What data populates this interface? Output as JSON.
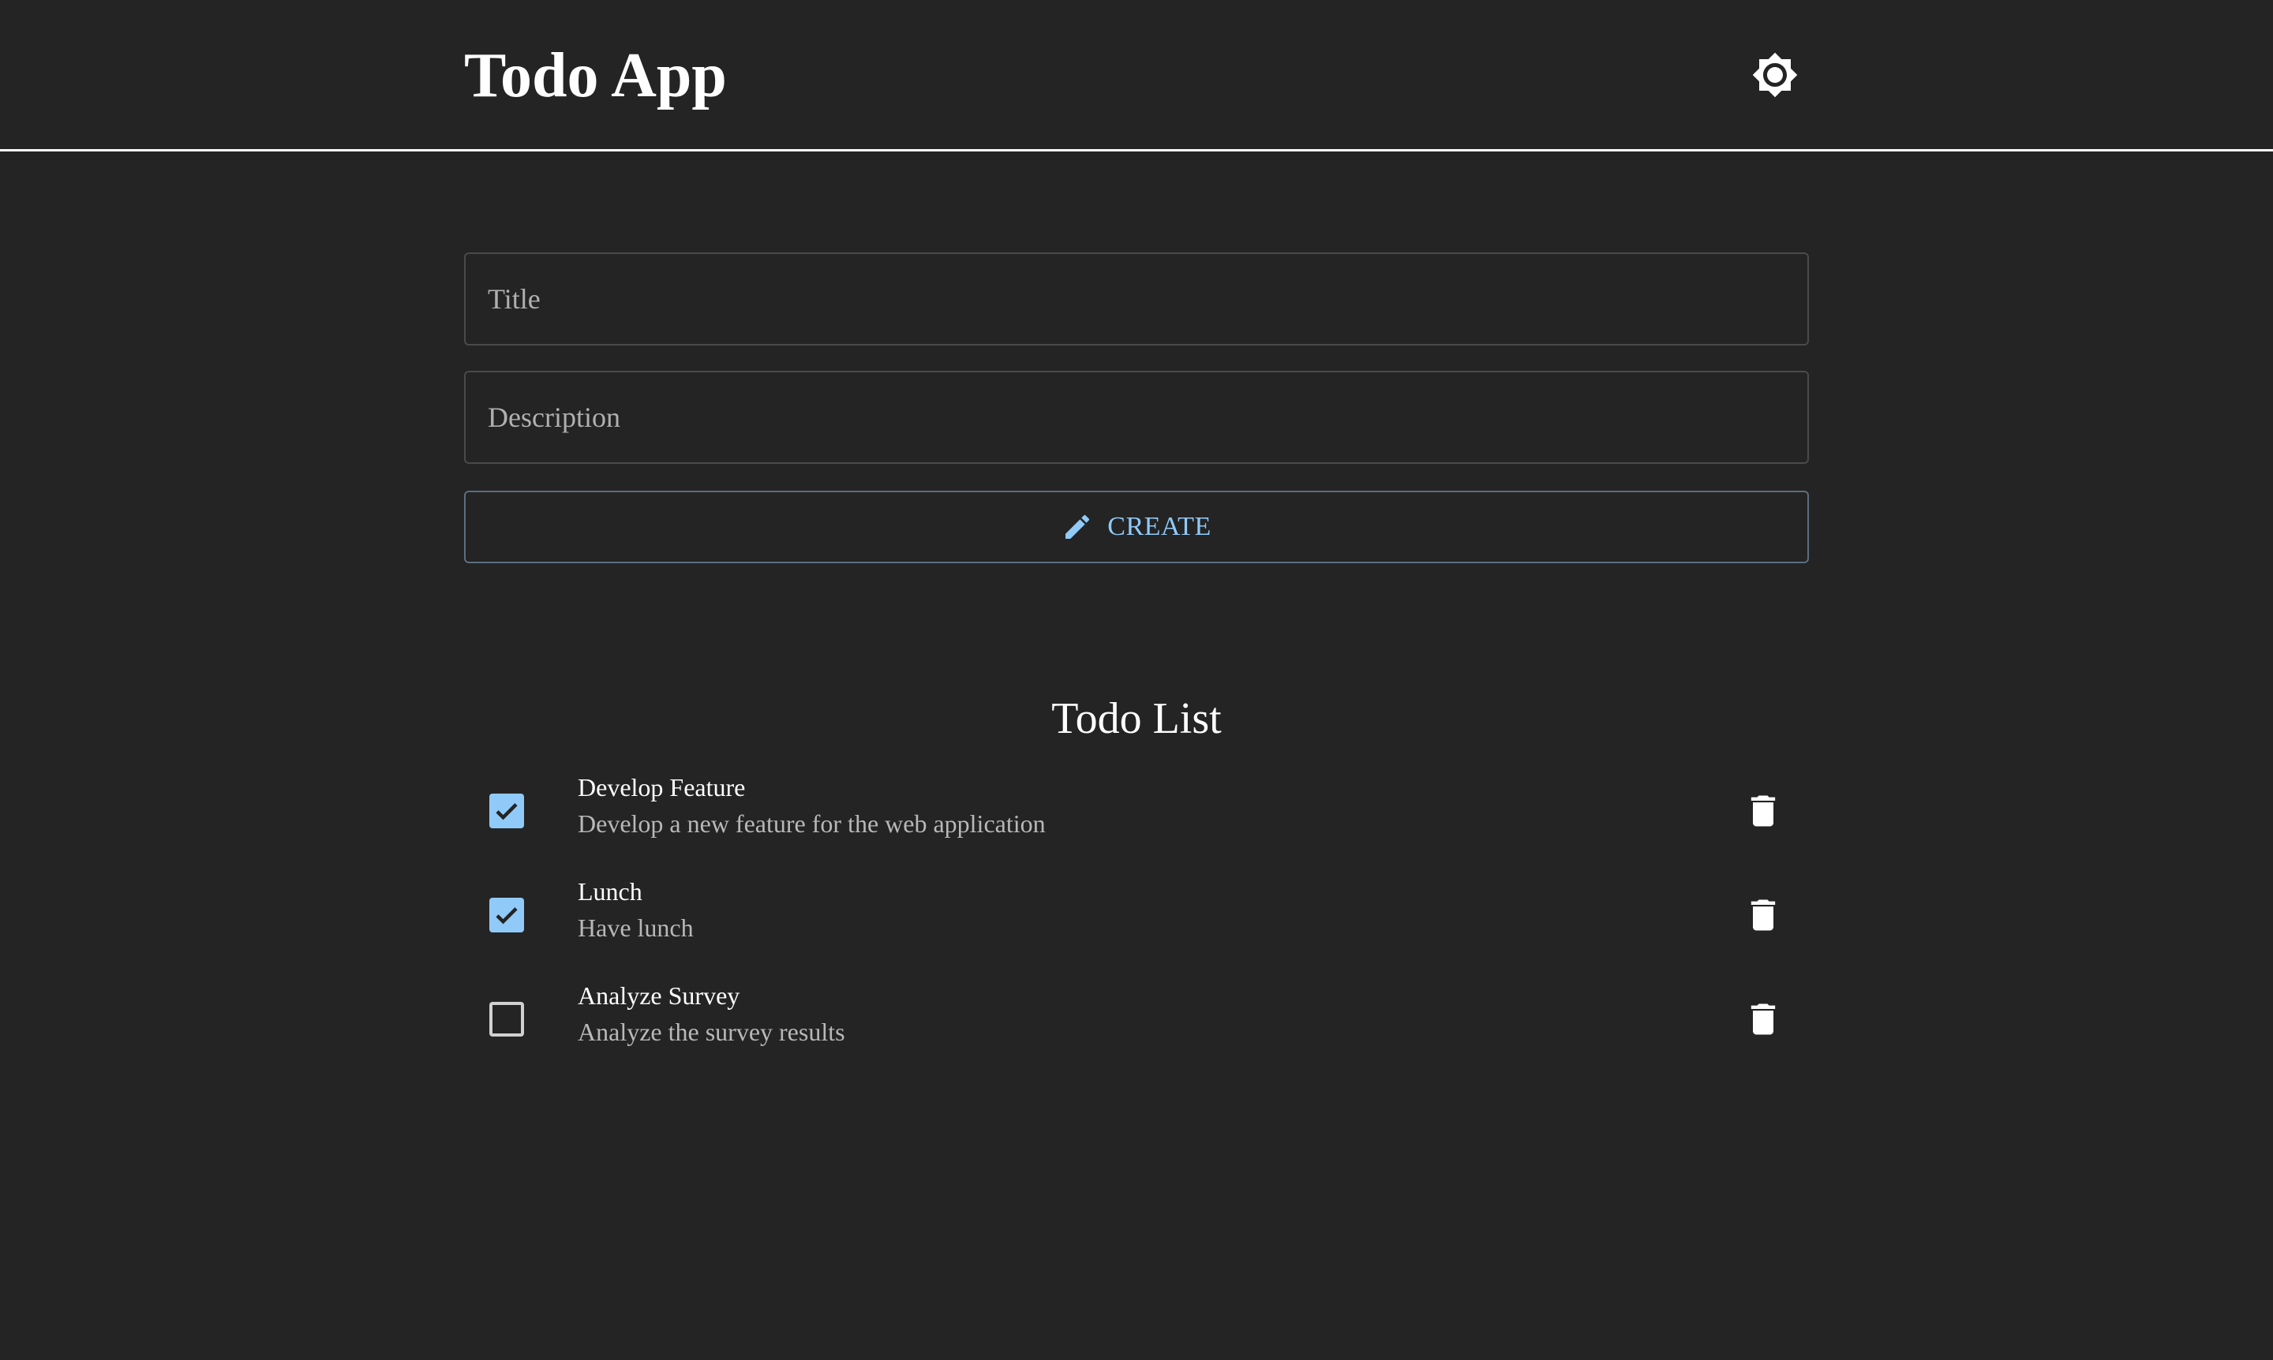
{
  "header": {
    "title": "Todo App",
    "theme_icon": "brightness-icon"
  },
  "form": {
    "title_placeholder": "Title",
    "title_value": "",
    "description_placeholder": "Description",
    "description_value": "",
    "create_label": "CREATE",
    "create_icon": "pencil-icon"
  },
  "list": {
    "heading": "Todo List",
    "items": [
      {
        "title": "Develop Feature",
        "description": "Develop a new feature for the web application",
        "completed": true
      },
      {
        "title": "Lunch",
        "description": "Have lunch",
        "completed": true
      },
      {
        "title": "Analyze Survey",
        "description": "Analyze the survey results",
        "completed": false
      }
    ]
  },
  "colors": {
    "background": "#242424",
    "accent": "#90caf9",
    "text": "#ffffff",
    "muted_text": "#b8b8b8"
  }
}
